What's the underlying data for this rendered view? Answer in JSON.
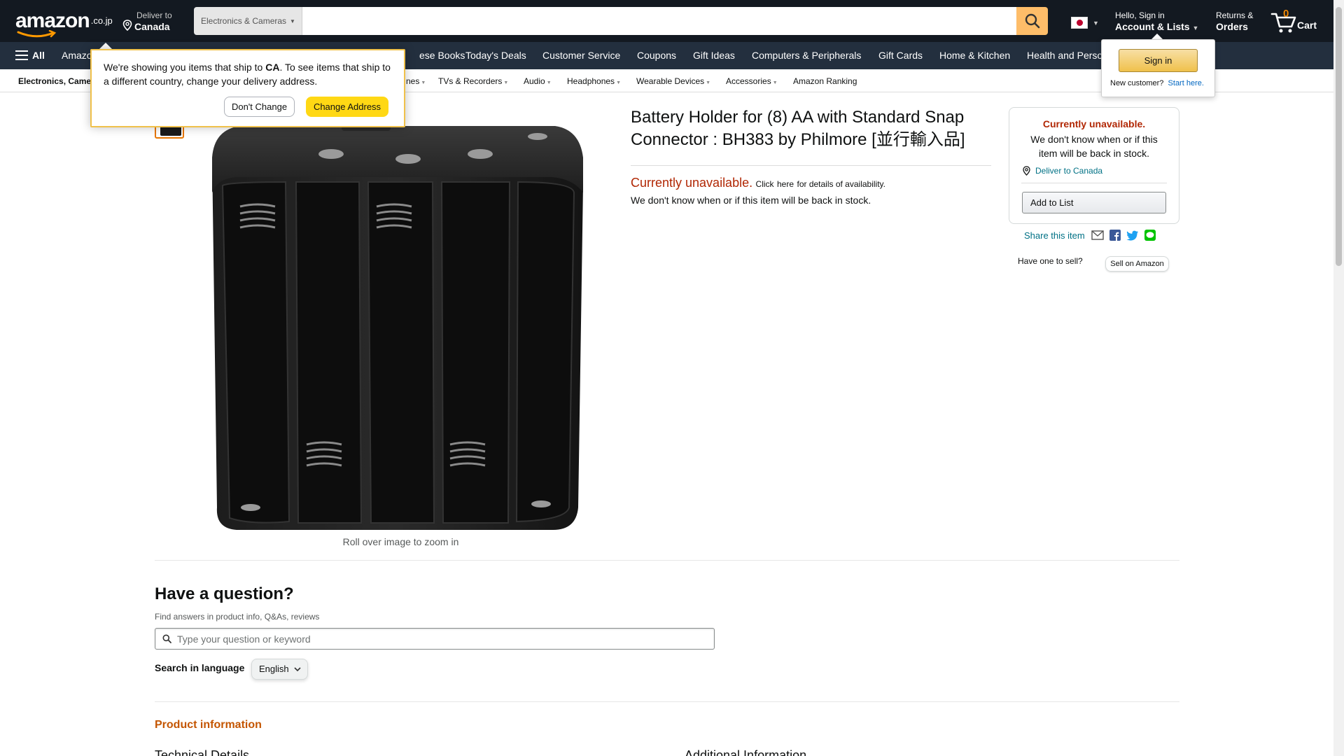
{
  "header": {
    "logo_text": "amazon",
    "logo_tld": ".co.jp",
    "deliver_line1": "Deliver to",
    "deliver_line2": "Canada",
    "search_category": "Electronics & Cameras",
    "search_value": "",
    "flag": "Japan",
    "account_line1": "Hello, Sign in",
    "account_line2": "Account & Lists",
    "returns_line1": "Returns &",
    "returns_line2": "Orders",
    "cart_count": "0",
    "cart_label": "Cart"
  },
  "nav": {
    "all_label": "All",
    "items": [
      "Amazon",
      "ese Books",
      "Today's Deals",
      "Customer Service",
      "Coupons",
      "Gift Ideas",
      "Computers & Peripherals",
      "Gift Cards",
      "Home & Kitchen",
      "Health and Perso"
    ]
  },
  "subnav": {
    "title": "Electronics, Came",
    "items": [
      "nes",
      "TVs & Recorders",
      "Audio",
      "Headphones",
      "Wearable Devices",
      "Accessories",
      "Amazon Ranking"
    ]
  },
  "popover": {
    "text_before": "We're showing you items that ship to ",
    "country": "CA",
    "text_after": ". To see items that ship to a different country, change your delivery address.",
    "dont_change": "Don't Change",
    "change_address": "Change Address"
  },
  "signin_flyout": {
    "button": "Sign in",
    "new_customer": "New customer?",
    "start_here": "Start here."
  },
  "product": {
    "title": "Battery Holder for (8) AA with Standard Snap Connector : BH383 by Philmore [並行輸入品]",
    "zoom_hint": "Roll over image to zoom in",
    "unavailable": "Currently unavailable.",
    "click": "Click",
    "here": "here",
    "details": "for details of availability.",
    "unknown": "We don't know when or if this item will be back in stock."
  },
  "buybox": {
    "unavailable": "Currently unavailable.",
    "desc": "We don't know when or if this item will be back in stock.",
    "deliver": "Deliver to Canada",
    "add_to_list": "Add to List",
    "share_label": "Share this item",
    "have_one": "Have one to sell?",
    "sell_button": "Sell on Amazon"
  },
  "question": {
    "title": "Have a question?",
    "subtitle": "Find answers in product info, Q&As, reviews",
    "placeholder": "Type your question or keyword",
    "lang_label": "Search in language",
    "lang_value": "English"
  },
  "product_info": {
    "title": "Product information",
    "technical": "Technical Details",
    "additional": "Additional Information"
  },
  "colors": {
    "topbar": "#131921",
    "navbar": "#232f3e",
    "search_button": "#febd69",
    "unavailable_red": "#b12704",
    "link": "#007185",
    "accent_orange": "#c45500"
  }
}
